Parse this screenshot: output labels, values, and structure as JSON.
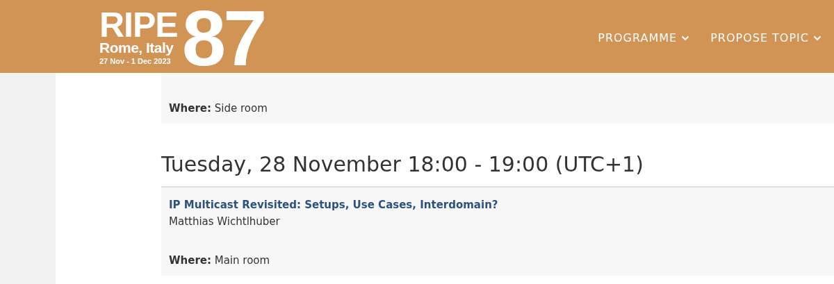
{
  "header": {
    "logo": {
      "name": "RIPE",
      "place": "Rome, Italy",
      "dates": "27 Nov - 1 Dec 2023",
      "number": "87"
    },
    "nav": [
      {
        "label": "PROGRAMME"
      },
      {
        "label": "PROPOSE TOPIC"
      }
    ]
  },
  "sessions": [
    {
      "kind": "card",
      "where": "**Where:** Side room"
    },
    {
      "kind": "heading",
      "text": "Tuesday, 28 November 18:00 - 19:00 (UTC+1)"
    },
    {
      "kind": "card",
      "title": "IP Multicast Revisited: Setups, Use Cases, Interdomain?",
      "speaker": "Matthias Wichtlhuber",
      "where": "**Where:** Main room"
    }
  ]
}
